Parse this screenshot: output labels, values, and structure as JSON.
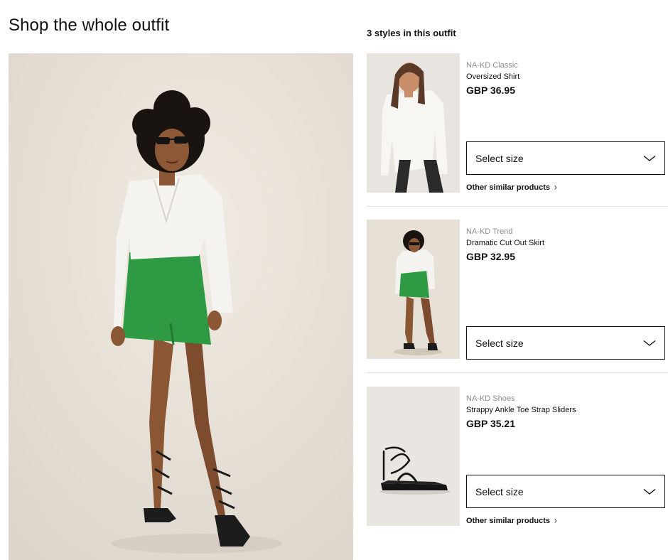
{
  "page": {
    "title": "Shop the whole outfit",
    "outfit_heading": "3 styles in this outfit"
  },
  "products": [
    {
      "brand": "NA-KD Classic",
      "name": "Oversized Shirt",
      "price": "GBP 36.95",
      "size_placeholder": "Select size",
      "similar_link": "Other similar products"
    },
    {
      "brand": "NA-KD Trend",
      "name": "Dramatic Cut Out Skirt",
      "price": "GBP 32.95",
      "size_placeholder": "Select size"
    },
    {
      "brand": "NA-KD Shoes",
      "name": "Strappy Ankle Toe Strap Sliders",
      "price": "GBP 35.21",
      "size_placeholder": "Select size",
      "similar_link": "Other similar products"
    }
  ],
  "icons": {
    "select_chevron": "chevron-down-icon",
    "link_arrow": "chevron-right-icon"
  },
  "colors": {
    "skirt_green": "#2f9a44",
    "border": "#111111",
    "divider": "#e2e2e2",
    "brand_grey": "#8a8a8a"
  }
}
